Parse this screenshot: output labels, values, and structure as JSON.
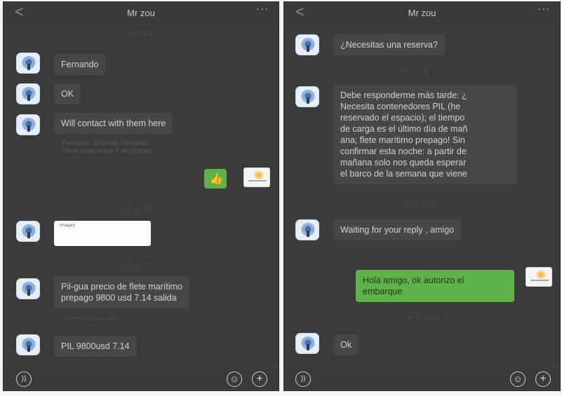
{
  "left": {
    "title": "Mr zou",
    "back_glyph": "<",
    "more_glyph": "···",
    "timestamps": [
      "05-21 4",
      "05-21 20",
      "05-22 2"
    ],
    "messages": [
      {
        "text": "Fernando"
      },
      {
        "text": "OK"
      },
      {
        "text": "Will contact with them here"
      },
      {
        "text": "Pil-gua precio de flete marítimo\nprepago 9800 usd   7.14 salida"
      },
      {
        "text": "PIL  9800usd  7.14"
      }
    ],
    "blurred_notes": [
      "Fernando: Estimado Fernando,\nFavor notar nuevo # de contrato",
      "blurred system text"
    ],
    "image_caption": "imagen",
    "thumbs_icon": "thumbs-up-icon",
    "voice_icon": "voice-icon",
    "emoji_icon": "emoji-icon",
    "plus_icon": "plus-icon"
  },
  "right": {
    "title": "Mr zou",
    "back_glyph": "<",
    "more_glyph": "···",
    "timestamps": [
      "05-21 20",
      "05-21 5:40",
      "05-21 8:40"
    ],
    "messages": [
      {
        "text": "¿Necesitas una reserva?"
      },
      {
        "text": "Debe responderme más tarde: ¿\nNecesita contenedores PIL (he\nreservado el espacio); el tiempo\nde carga es el último día de mañ\nana; flete marítimo prepago! Sin\nconfirmar esta noche: a partir de\nmañana solo nos queda esperar\nel barco de la semana que viene"
      },
      {
        "text": "Waiting for your reply , amigo"
      },
      {
        "text": "Hola amigo, ok autorizo el\nembarque"
      },
      {
        "text": "Ok"
      }
    ],
    "voice_icon": "voice-icon",
    "emoji_icon": "emoji-icon",
    "plus_icon": "plus-icon"
  },
  "colors": {
    "chat_background": "#3b3b3b",
    "incoming_bubble": "#474747",
    "outgoing_bubble": "#5fb24a"
  }
}
